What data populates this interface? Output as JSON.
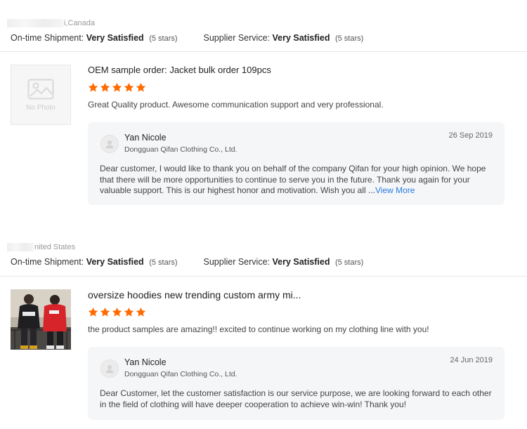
{
  "reviews": [
    {
      "location": "i,Canada",
      "ontime_label": "On-time Shipment:",
      "ontime_value": "Very Satisfied",
      "ontime_stars": "(5 stars)",
      "supplier_label": "Supplier Service:",
      "supplier_value": "Very Satisfied",
      "supplier_stars": "(5 stars)",
      "no_photo": "No Photo",
      "title": "OEM sample order: Jacket bulk order 109pcs",
      "rating": 5,
      "comment": "Great Quality product. Awesome communication support and very professional.",
      "reply": {
        "name": "Yan Nicole",
        "company": "Dongguan Qifan Clothing Co., Ltd.",
        "date": "26 Sep 2019",
        "line1": "Dear customer, I would like to thank you on behalf of the company  Qifan for your high opinion. We hope",
        "line2": "that there will be more opportunities to continue to serve you in the future. Thank you again for your",
        "line3": "valuable support. This is our highest honor and motivation. Wish you all ...",
        "view_more": "View More"
      }
    },
    {
      "location": "nited States",
      "ontime_label": "On-time Shipment:",
      "ontime_value": "Very Satisfied",
      "ontime_stars": "(5 stars)",
      "supplier_label": "Supplier Service:",
      "supplier_value": "Very Satisfied",
      "supplier_stars": "(5 stars)",
      "title": "oversize hoodies new trending custom army mi...",
      "rating": 5,
      "comment": "the product samples are amazing!! excited to continue working on my clothing line with you!",
      "reply": {
        "name": "Yan Nicole",
        "company": "Dongguan Qifan Clothing Co., Ltd.",
        "date": "24 Jun 2019",
        "line1": "Dear Customer,  let the customer satisfaction is our service purpose, we are looking forward to each other",
        "line2": "in the field of clothing will have deeper cooperation to achieve win-win! Thank you!"
      }
    }
  ],
  "colors": {
    "star": "#ff6a00",
    "link": "#2a7ae2",
    "reply_bg": "#f5f6f8"
  },
  "icons": {
    "star": "star-icon",
    "placeholder": "image-placeholder-icon",
    "avatar": "avatar-icon"
  }
}
